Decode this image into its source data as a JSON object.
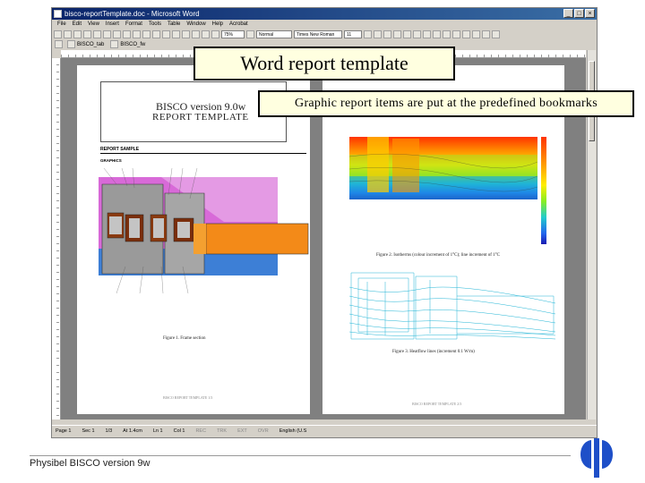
{
  "slide": {
    "callout_title": "Word report template",
    "callout_subtitle": "Graphic report items are put at the predefined bookmarks",
    "footer": "Physibel BISCO version 9w",
    "colors": {
      "callout_bg": "#ffffe0",
      "logo_blue": "#1e4fc8",
      "titlebar": "#0a246a"
    }
  },
  "window": {
    "title": "bisco-reportTemplate.doc - Microsoft Word",
    "menu": [
      "File",
      "Edit",
      "View",
      "Insert",
      "Format",
      "Tools",
      "Table",
      "Window",
      "Help",
      "Acrobat"
    ],
    "toolbar": {
      "zoom": "75%",
      "style": "Normal",
      "font": "Times New Roman",
      "size": "11"
    },
    "toolbar2": {
      "bisco_tab": "BISCO_tab",
      "bisco_fw": "BISCO_fw"
    },
    "status": {
      "page": "Page 1",
      "sec": "Sec 1",
      "pages": "1/3",
      "at": "At 1.4cm",
      "ln": "Ln 1",
      "col": "Col 1",
      "flags": [
        "REC",
        "TRK",
        "EXT",
        "OVR"
      ],
      "lang": "English (U.S"
    }
  },
  "doc": {
    "page1": {
      "title_line1": "BISCO version 9.0w",
      "title_line2": "REPORT TEMPLATE",
      "heading": "REPORT SAMPLE",
      "graphics": "GRAPHICS",
      "caption": "Figure 1. Frame section",
      "footer": "BISCO REPORT TEMPLATE 1/3"
    },
    "page2": {
      "caption1": "Figure 2. Isotherms (colour increment of 1°C); line increment of 1°C",
      "caption2": "Figure 3. Heatflow lines (increment 0.1 W/m)",
      "footer": "BISCO REPORT TEMPLATE 2/3"
    }
  },
  "icons": [
    "app-icon",
    "minimize-icon",
    "maximize-icon",
    "close-icon",
    "physibel-logo"
  ]
}
